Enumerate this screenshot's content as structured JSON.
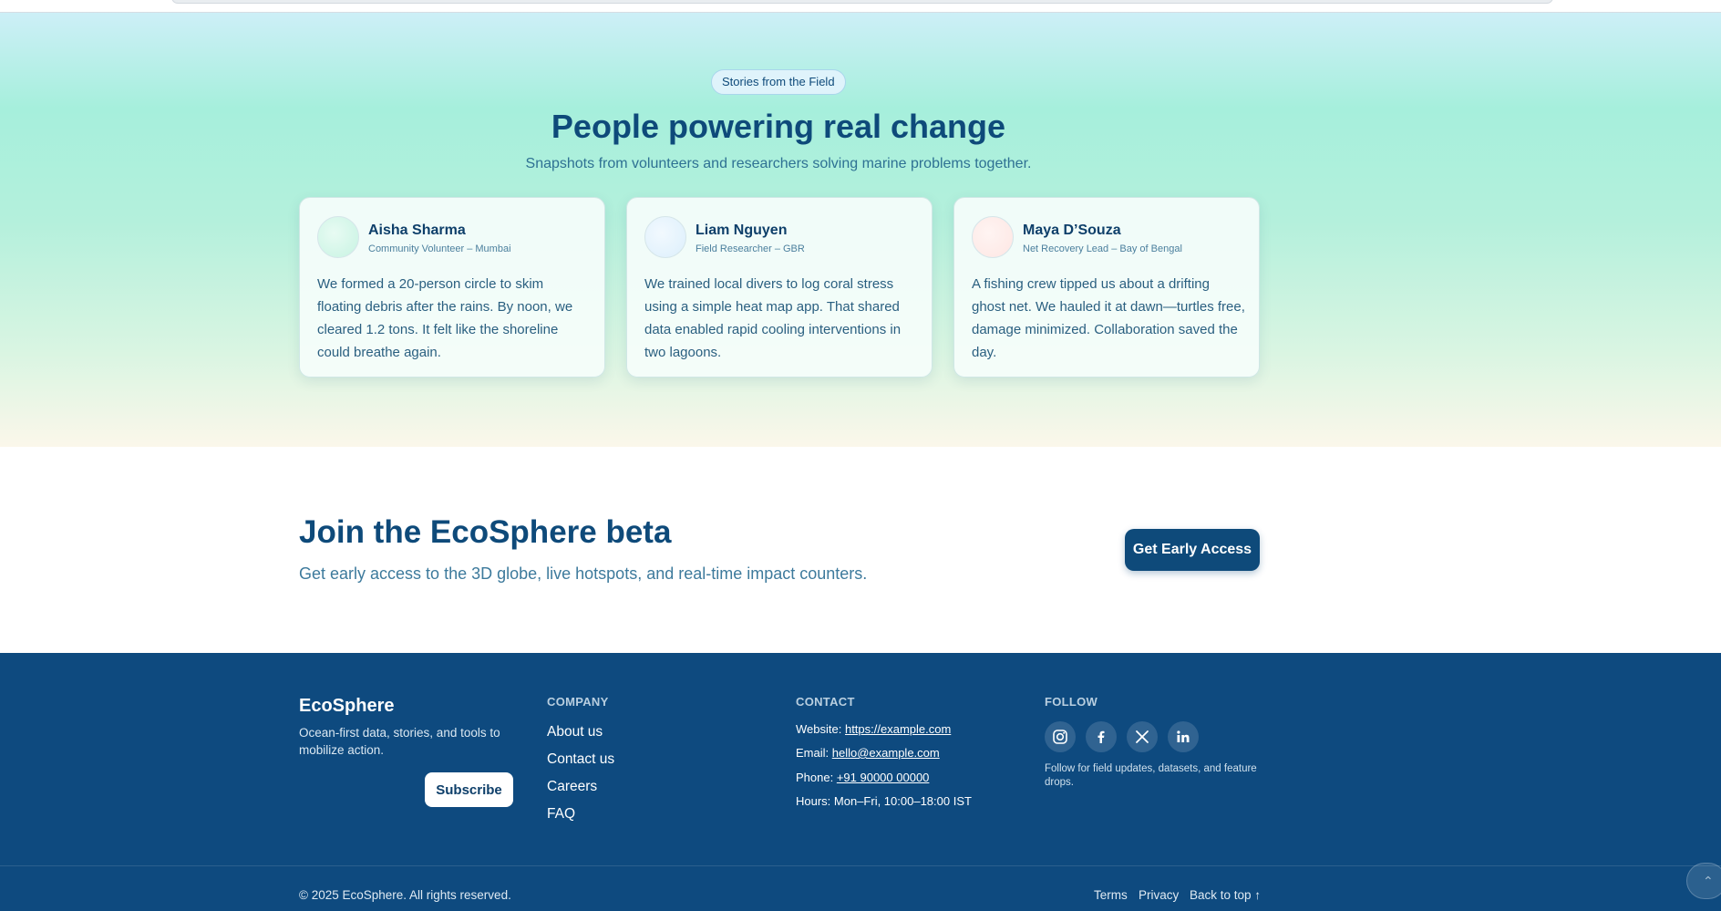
{
  "stories": {
    "badge": "Stories from the Field",
    "title": "People powering real change",
    "subtitle": "Snapshots from volunteers and researchers solving marine problems together.",
    "cards": [
      {
        "name": "Aisha Sharma",
        "role": "Community Volunteer – Mumbai",
        "quote": "We formed a 20-person circle to skim floating debris after the rains. By noon, we cleared 1.2 tons. It felt like the shoreline could breathe again.",
        "avatar_color": "#c7f3e2"
      },
      {
        "name": "Liam Nguyen",
        "role": "Field Researcher – GBR",
        "quote": "We trained local divers to log coral stress using a simple heat map app. That shared data enabled rapid cooling interventions in two lagoons.",
        "avatar_color": "#dceffc"
      },
      {
        "name": "Maya D’Souza",
        "role": "Net Recovery Lead – Bay of Bengal",
        "quote": "A fishing crew tipped us about a drifting ghost net. We hauled it at dawn—turtles free, damage minimized. Collaboration saved the day.",
        "avatar_color": "#fde6e3"
      }
    ]
  },
  "beta": {
    "title": "Join the EcoSphere beta",
    "subtitle": "Get early access to the 3D globe, live hotspots, and real-time impact counters.",
    "cta_label": "Get Early Access"
  },
  "footer": {
    "brand": "EcoSphere",
    "tagline": "Ocean-first data, stories, and tools to mobilize action.",
    "subscribe_label": "Subscribe",
    "company": {
      "heading": "COMPANY",
      "links": [
        "About us",
        "Contact us",
        "Careers",
        "FAQ"
      ]
    },
    "contact": {
      "heading": "CONTACT",
      "website_label": "Website:",
      "website": "https://example.com",
      "email_label": "Email:",
      "email": "hello@example.com",
      "phone_label": "Phone:",
      "phone": "+91 90000 00000",
      "hours": "Hours: Mon–Fri, 10:00–18:00 IST"
    },
    "follow": {
      "heading": "FOLLOW",
      "icons": [
        "instagram-icon",
        "facebook-icon",
        "x-icon",
        "linkedin-icon"
      ],
      "note": "Follow for field updates, datasets, and feature drops."
    },
    "copyright": "© 2025 EcoSphere. All rights reserved.",
    "bottom_links": {
      "terms": "Terms",
      "privacy": "Privacy",
      "back_to_top": "Back to top ↑"
    }
  },
  "colors": {
    "primary": "#0e4a7a",
    "footer_bg": "#0e4a7f",
    "accent_mint": "#a6efdc"
  }
}
